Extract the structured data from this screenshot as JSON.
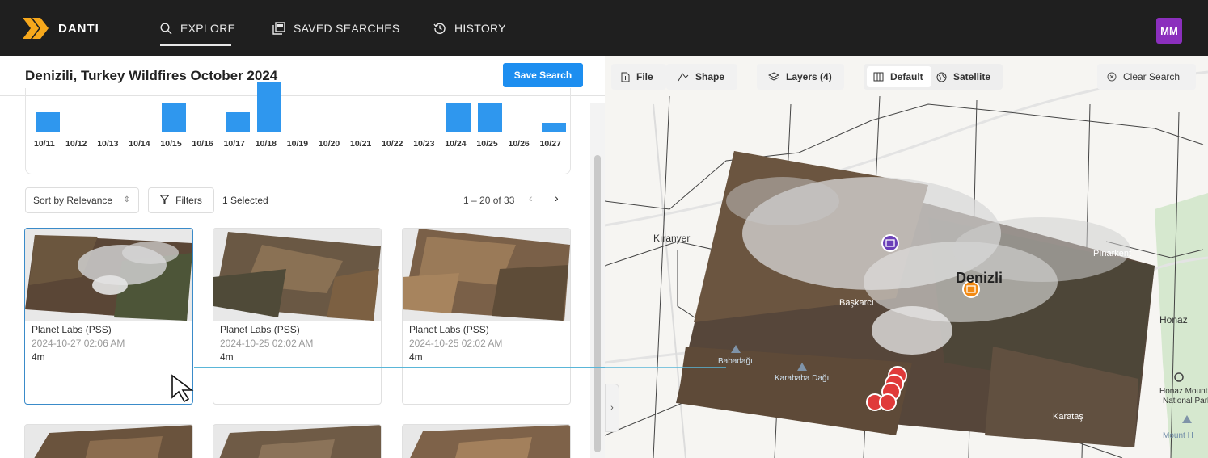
{
  "brand": {
    "name": "DANTI"
  },
  "nav": {
    "explore": "EXPLORE",
    "saved": "SAVED SEARCHES",
    "history": "HISTORY"
  },
  "user": {
    "initials": "MM",
    "avatar_color": "#8b2fbd"
  },
  "search": {
    "title": "Denizili, Turkey Wildfires October 2024",
    "save_label": "Save Search"
  },
  "histogram": {
    "dates": [
      "10/11",
      "10/12",
      "10/13",
      "10/14",
      "10/15",
      "10/16",
      "10/17",
      "10/18",
      "10/19",
      "10/20",
      "10/21",
      "10/22",
      "10/23",
      "10/24",
      "10/25",
      "10/26",
      "10/27"
    ],
    "counts": [
      2,
      0,
      0,
      0,
      3,
      0,
      2,
      5,
      0,
      0,
      0,
      0,
      0,
      3,
      3,
      0,
      1
    ],
    "color": "#2f97ee"
  },
  "controls": {
    "sort": "Sort by Relevance",
    "filters": "Filters",
    "selected": "1 Selected",
    "pagination": "1 – 20 of 33"
  },
  "results": [
    {
      "provider": "Planet Labs (PSS)",
      "date": "2024-10-27 02:06 AM",
      "resolution": "4m",
      "selected": true
    },
    {
      "provider": "Planet Labs (PSS)",
      "date": "2024-10-25 02:02 AM",
      "resolution": "4m",
      "selected": false
    },
    {
      "provider": "Planet Labs (PSS)",
      "date": "2024-10-25 02:02 AM",
      "resolution": "4m",
      "selected": false
    }
  ],
  "map_toolbar": {
    "file": "File",
    "shape": "Shape",
    "layers": "Layers (4)",
    "default": "Default",
    "satellite": "Satellite",
    "clear": "Clear Search"
  },
  "map_labels": {
    "kiranyer": "Kıranyer",
    "pinarkent": "Pınarkent",
    "denizli": "Denizli",
    "baskarci": "Başkarcı",
    "honaz": "Honaz",
    "honaz_park": "Honaz Mounta National Park",
    "mount": "Mount H",
    "karatas": "Karataş",
    "babadagi": "Babadağı",
    "karatepe": "Karababa Dağı"
  }
}
